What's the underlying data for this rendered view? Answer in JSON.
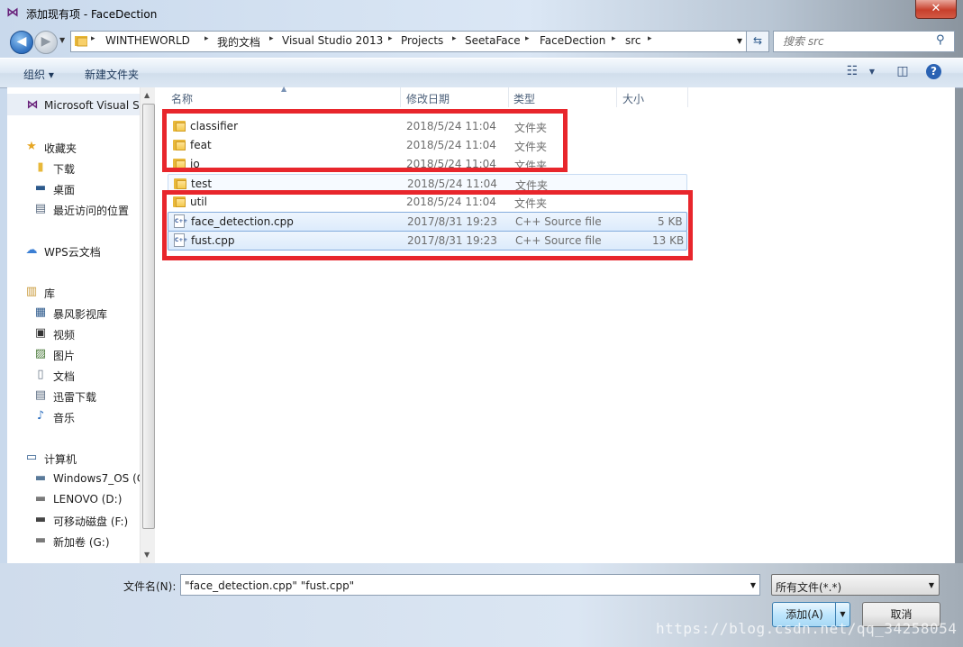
{
  "window": {
    "title": "添加现有项 - FaceDection",
    "app_icon": "visual-studio-icon",
    "close_label": "✕"
  },
  "address": {
    "breadcrumbs": [
      "WINTHEWORLD",
      "我的文档",
      "Visual Studio 2013",
      "Projects",
      "SeetaFace",
      "FaceDection",
      "src"
    ]
  },
  "search": {
    "placeholder": "搜索 src"
  },
  "toolbar": {
    "organize_label": "组织 ▾",
    "new_folder_label": "新建文件夹"
  },
  "nav": {
    "items": [
      {
        "label": "Microsoft Visual S",
        "icon": "visual-studio-icon"
      },
      {
        "label": "收藏夹",
        "icon": "star-icon"
      },
      {
        "label": "下载",
        "icon": "folder-icon"
      },
      {
        "label": "桌面",
        "icon": "desktop-icon"
      },
      {
        "label": "最近访问的位置",
        "icon": "recent-places-icon"
      },
      {
        "label": "WPS云文档",
        "icon": "cloud-icon"
      },
      {
        "label": "库",
        "icon": "library-icon"
      },
      {
        "label": "暴风影视库",
        "icon": "video-library-icon"
      },
      {
        "label": "视频",
        "icon": "video-icon"
      },
      {
        "label": "图片",
        "icon": "picture-icon"
      },
      {
        "label": "文档",
        "icon": "document-icon"
      },
      {
        "label": "迅雷下载",
        "icon": "download-icon"
      },
      {
        "label": "音乐",
        "icon": "music-icon"
      },
      {
        "label": "计算机",
        "icon": "computer-icon"
      },
      {
        "label": "Windows7_OS (C",
        "icon": "drive-icon"
      },
      {
        "label": "LENOVO (D:)",
        "icon": "drive-icon"
      },
      {
        "label": "可移动磁盘 (F:)",
        "icon": "removable-drive-icon"
      },
      {
        "label": "新加卷 (G:)",
        "icon": "drive-icon"
      }
    ]
  },
  "columns": {
    "name": "名称",
    "modified": "修改日期",
    "type": "类型",
    "size": "大小"
  },
  "files": [
    {
      "name": "classifier",
      "modified": "2018/5/24 11:04",
      "type": "文件夹",
      "size": ""
    },
    {
      "name": "feat",
      "modified": "2018/5/24 11:04",
      "type": "文件夹",
      "size": ""
    },
    {
      "name": "io",
      "modified": "2018/5/24 11:04",
      "type": "文件夹",
      "size": ""
    },
    {
      "name": "test",
      "modified": "2018/5/24 11:04",
      "type": "文件夹",
      "size": ""
    },
    {
      "name": "util",
      "modified": "2018/5/24 11:04",
      "type": "文件夹",
      "size": ""
    },
    {
      "name": "face_detection.cpp",
      "modified": "2017/8/31 19:23",
      "type": "C++ Source file",
      "size": "5 KB"
    },
    {
      "name": "fust.cpp",
      "modified": "2017/8/31 19:23",
      "type": "C++ Source file",
      "size": "13 KB"
    }
  ],
  "footer": {
    "filename_label": "文件名(N):",
    "filename_value": "\"face_detection.cpp\" \"fust.cpp\"",
    "filter_value": "所有文件(*.*)",
    "add_label": "添加(A)",
    "cancel_label": "取消"
  },
  "watermark": "https://blog.csdn.net/qq_34258054",
  "colors": {
    "highlight_box": "#e8262c",
    "selection": "#dcebfc",
    "vs_purple": "#68217a"
  }
}
